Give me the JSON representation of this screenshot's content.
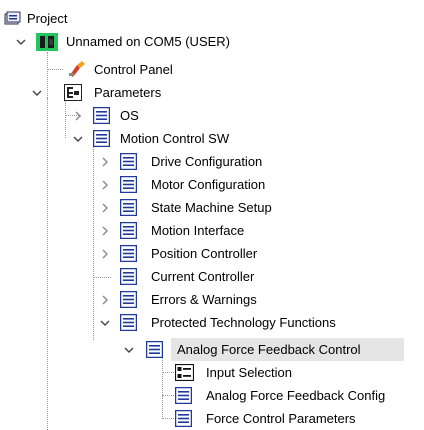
{
  "tree": {
    "project": "Project",
    "device": "Unnamed on COM5 (USER)",
    "control_panel": "Control Panel",
    "parameters": "Parameters",
    "os": "OS",
    "motion_control_sw": "Motion Control SW",
    "drive_configuration": "Drive Configuration",
    "motor_configuration": "Motor Configuration",
    "state_machine_setup": "State Machine Setup",
    "motion_interface": "Motion Interface",
    "position_controller": "Position Controller",
    "current_controller": "Current Controller",
    "errors_warnings": "Errors & Warnings",
    "protected_technology_functions": "Protected Technology Functions",
    "analog_force_feedback_control": "Analog Force Feedback Control",
    "input_selection": "Input Selection",
    "analog_force_feedback_config": "Analog Force Feedback Config",
    "force_control_parameters": "Force Control Parameters"
  },
  "colors": {
    "selection": "#e5e5e5",
    "icon_blue": "#1f3a9a",
    "chip_green": "#22c55e",
    "tree_line": "#9a9a9a"
  },
  "icons": {
    "project": "project-icon",
    "device": "device-chip-icon",
    "control_panel": "control-panel-icon",
    "parameters": "parameters-group-icon",
    "node": "document-list-icon",
    "selection": "selection-list-icon"
  }
}
